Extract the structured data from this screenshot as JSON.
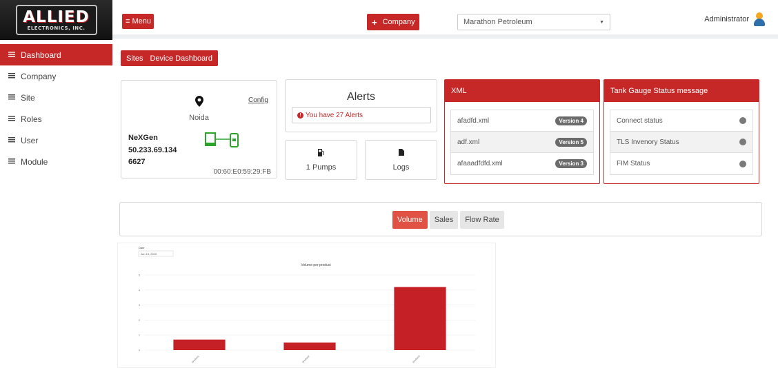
{
  "brand": {
    "logo_main": "ALLIED",
    "logo_sub": "ELECTRONICS, INC."
  },
  "sidebar": {
    "items": [
      {
        "label": "Dashboard",
        "active": true
      },
      {
        "label": "Company"
      },
      {
        "label": "Site"
      },
      {
        "label": "Roles"
      },
      {
        "label": "User"
      },
      {
        "label": "Module"
      }
    ]
  },
  "topbar": {
    "menu_label": "≡ Menu",
    "company_button": "Company",
    "company_select": "Marathon Petroleum",
    "user": "Administrator"
  },
  "breadcrumb": {
    "items": [
      "Sites",
      "Device Dashboard"
    ]
  },
  "device": {
    "config_link": "Config",
    "location": "Noida",
    "name": "NeXGen",
    "ip": "50.233.69.134",
    "port": "6627",
    "mac": "00:60:E0:59:29:FB"
  },
  "alerts": {
    "title": "Alerts",
    "message": "You have 27 Alerts"
  },
  "pumps": {
    "label": "1 Pumps"
  },
  "logs": {
    "label": "Logs"
  },
  "xml_panel": {
    "title": "XML",
    "rows": [
      {
        "file": "afadfd.xml",
        "version": "Version 4"
      },
      {
        "file": "adf.xml",
        "version": "Version 5"
      },
      {
        "file": "afaaadfdfd.xml",
        "version": "Version 3"
      }
    ]
  },
  "tank_panel": {
    "title": "Tank Gauge Status message",
    "rows": [
      {
        "label": "Connect status"
      },
      {
        "label": "TLS Invenory Status"
      },
      {
        "label": "FIM Status"
      }
    ]
  },
  "tabs": [
    "Volume",
    "Sales",
    "Flow Rate"
  ],
  "active_tab": "Volume",
  "colors": {
    "accent": "#c62828",
    "bar": "#c62027",
    "status_dot": "#7a7a7a"
  },
  "chart_data": {
    "type": "bar",
    "title": "Volume per product",
    "date_label": "Date",
    "date_value": "Jun 13, 2019",
    "categories": [
      "product1",
      "product2",
      "product3"
    ],
    "values": [
      0.7,
      0.5,
      4.2
    ],
    "ylim": [
      0,
      5
    ],
    "yticks": [
      0,
      1,
      2,
      3,
      4,
      5
    ],
    "grid": true
  }
}
